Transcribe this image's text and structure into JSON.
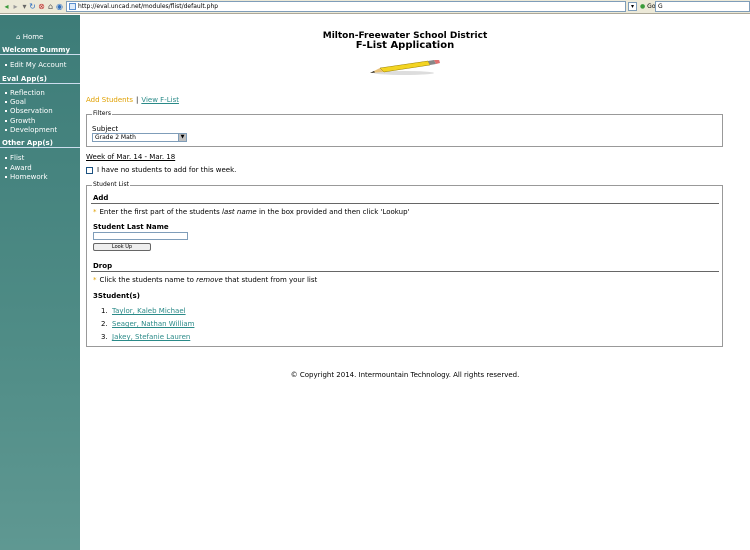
{
  "browser": {
    "url": "http://eval.uncad.net/modules/flist/default.php",
    "go_label": "Go",
    "search_value": "G"
  },
  "sidebar": {
    "home": "Home",
    "welcome": "Welcome Dummy",
    "edit_account": "Edit My Account",
    "eval_apps_header": "Eval App(s)",
    "eval_apps": [
      "Reflection",
      "Goal",
      "Observation",
      "Growth",
      "Development"
    ],
    "other_apps_header": "Other App(s)",
    "other_apps": [
      "Flist",
      "Award",
      "Homework"
    ]
  },
  "header": {
    "district": "Milton-Freewater School District",
    "app": "F-List Application"
  },
  "nav": {
    "add": "Add Students",
    "separator": "|",
    "view": "View F-List"
  },
  "filters": {
    "legend": "Filters",
    "subject_label": "Subject",
    "subject_value": "Grade 2 Math"
  },
  "week": {
    "label": "Week of Mar. 14 - Mar. 18",
    "no_students_label": "I have no students to add for this week."
  },
  "student_list": {
    "legend": "Student List",
    "add_header": "Add",
    "add_instructions_pre": "Enter the first part of the students ",
    "add_instructions_em": "last name",
    "add_instructions_post": " in the box provided and then click 'Lookup'",
    "last_name_label": "Student Last Name",
    "last_name_value": "",
    "lookup_button": "Look Up",
    "drop_header": "Drop",
    "drop_instructions_pre": "Click the students name to ",
    "drop_instructions_em": "remove",
    "drop_instructions_post": " that student from your list",
    "count": "3Student(s)",
    "students": [
      {
        "num": "1.",
        "name": "Taylor, Kaleb Michael"
      },
      {
        "num": "2.",
        "name": "Seager, Nathan William"
      },
      {
        "num": "3.",
        "name": "Jakey, Stefanie Lauren"
      }
    ]
  },
  "footer": {
    "copyright": "© Copyright 2014. Intermountain Technology. All rights reserved."
  }
}
